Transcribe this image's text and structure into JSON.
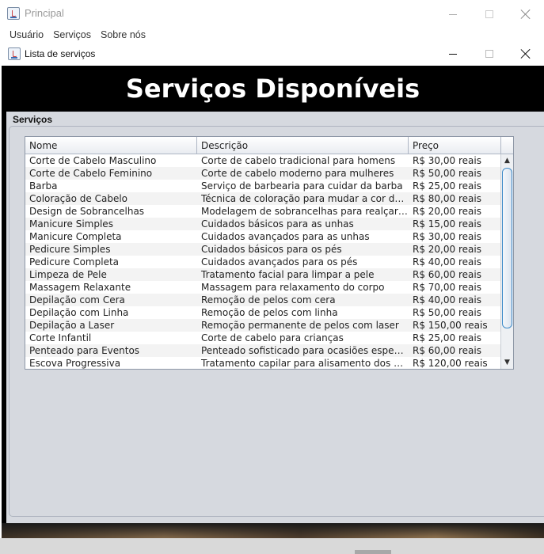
{
  "outer_window": {
    "title": "Principal",
    "menu": [
      "Usuário",
      "Serviços",
      "Sobre nós"
    ]
  },
  "inner_window": {
    "title": "Lista de serviços",
    "heading": "Serviços Disponíveis",
    "group_label": "Serviços"
  },
  "table": {
    "columns": [
      "Nome",
      "Descrição",
      "Preço"
    ],
    "rows": [
      [
        "Corte de Cabelo Masculino",
        "Corte de cabelo tradicional para homens",
        "R$ 30,00 reais"
      ],
      [
        "Corte de Cabelo Feminino",
        "Corte de cabelo moderno para mulheres",
        "R$ 50,00 reais"
      ],
      [
        "Barba",
        "Serviço de barbearia para cuidar da barba",
        "R$ 25,00 reais"
      ],
      [
        "Coloração de Cabelo",
        "Técnica de coloração para mudar a cor do ca...",
        "R$ 80,00 reais"
      ],
      [
        "Design de Sobrancelhas",
        "Modelagem de sobrancelhas para realçar o ...",
        "R$ 20,00 reais"
      ],
      [
        "Manicure Simples",
        "Cuidados básicos para as unhas",
        "R$ 15,00 reais"
      ],
      [
        "Manicure Completa",
        "Cuidados avançados para as unhas",
        "R$ 30,00 reais"
      ],
      [
        "Pedicure Simples",
        "Cuidados básicos para os pés",
        "R$ 20,00 reais"
      ],
      [
        "Pedicure Completa",
        "Cuidados avançados para os pés",
        "R$ 40,00 reais"
      ],
      [
        "Limpeza de Pele",
        "Tratamento facial para limpar a pele",
        "R$ 60,00 reais"
      ],
      [
        "Massagem Relaxante",
        "Massagem para relaxamento do corpo",
        "R$ 70,00 reais"
      ],
      [
        "Depilação com Cera",
        "Remoção de pelos com cera",
        "R$ 40,00 reais"
      ],
      [
        "Depilação com Linha",
        "Remoção de pelos com linha",
        "R$ 50,00 reais"
      ],
      [
        "Depilação a Laser",
        "Remoção permanente de pelos com laser",
        "R$ 150,00 reais"
      ],
      [
        "Corte Infantil",
        "Corte de cabelo para crianças",
        "R$ 25,00 reais"
      ],
      [
        "Penteado para Eventos",
        "Penteado sofisticado para ocasiões especiais",
        "R$ 60,00 reais"
      ],
      [
        "Escova Progressiva",
        "Tratamento capilar para alisamento dos fios",
        "R$ 120,00 reais"
      ]
    ]
  },
  "icons": {
    "app": "java-icon",
    "minimize": "minimize-icon",
    "maximize": "maximize-icon",
    "close": "close-icon",
    "scroll_up": "▲",
    "scroll_down": "▼"
  },
  "colors": {
    "banner_bg": "#000000",
    "banner_text": "#ffffff",
    "panel_bg": "#d6d9df",
    "scroll_thumb_border": "#3e8ac8"
  }
}
